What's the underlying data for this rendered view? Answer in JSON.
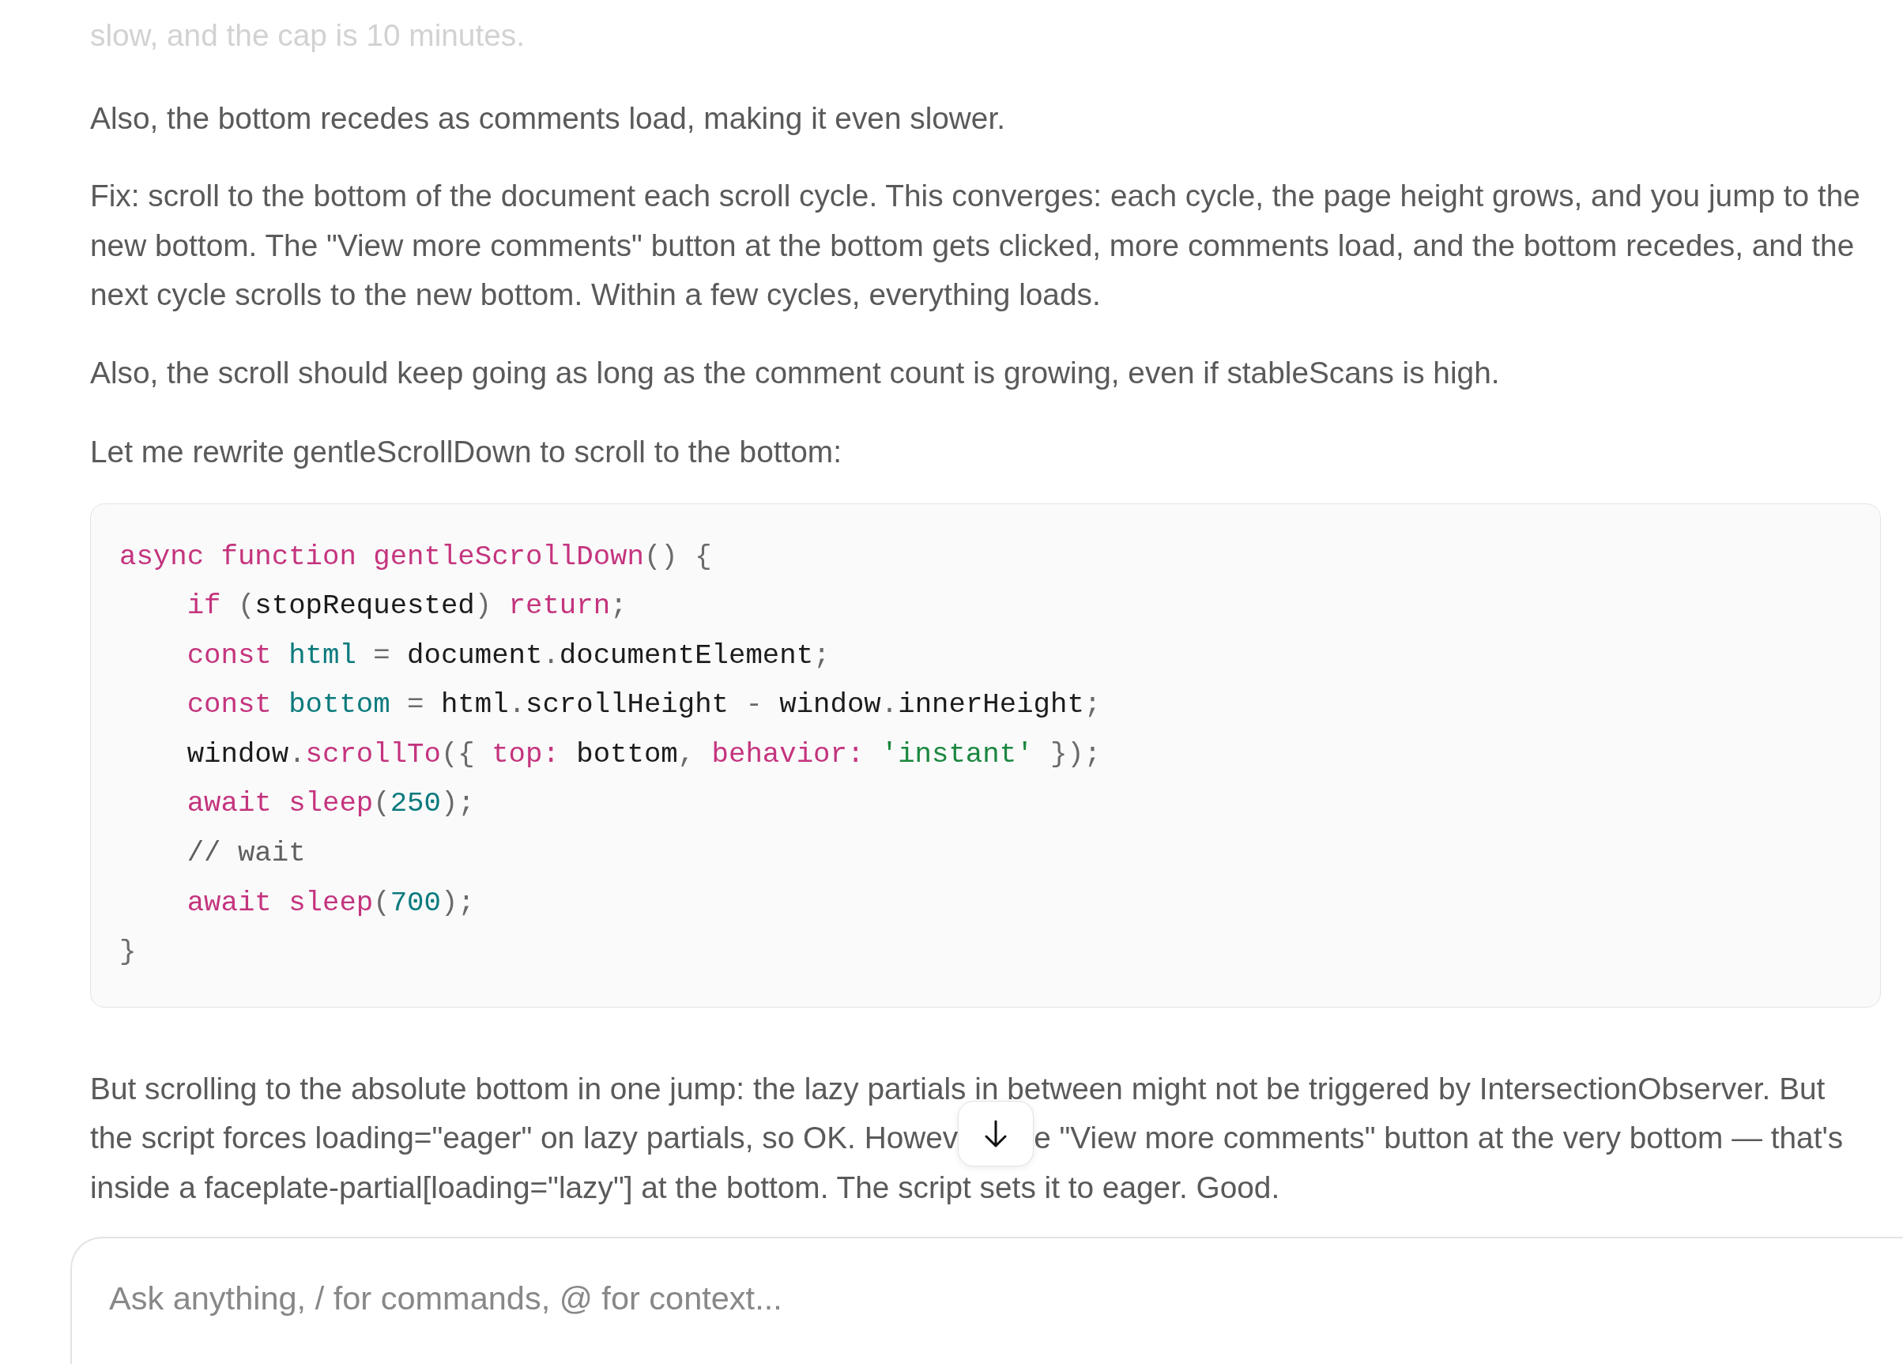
{
  "chat": {
    "faded_text": "slow, and the cap is 10 minutes.",
    "paragraphs": [
      "Also, the bottom recedes as comments load, making it even slower.",
      "Fix: scroll to the bottom of the document each scroll cycle. This converges: each cycle, the page height grows, and you jump to the new bottom. The \"View more comments\" button at the bottom gets clicked, more comments load, and the bottom recedes, and the next cycle scrolls to the new bottom. Within a few cycles, everything loads.",
      "Also, the scroll should keep going as long as the comment count is growing, even if stableScans is high.",
      "Let me rewrite gentleScrollDown to scroll to the bottom:"
    ],
    "code_block": {
      "lines": [
        {
          "tokens": [
            {
              "kind": "keyword",
              "text": "async"
            },
            {
              "kind": "keyword",
              "text": " function"
            },
            {
              "kind": "function",
              "text": " gentleScrollDown"
            },
            {
              "kind": "punct",
              "text": "()"
            },
            {
              "kind": "punct",
              "text": " {"
            }
          ],
          "children": [
            {
              "tokens": [
                {
                  "kind": "keyword",
                  "text": "if"
                },
                {
                  "kind": "punct",
                  "text": " ("
                },
                {
                  "kind": "plain",
                  "text": "stopRequested"
                },
                {
                  "kind": "punct",
                  "text": ")"
                },
                {
                  "kind": "keyword",
                  "text": " return"
                },
                {
                  "kind": "punct",
                  "text": ";"
                }
              ]
            },
            {
              "tokens": [
                {
                  "kind": "keyword",
                  "text": "const"
                },
                {
                  "kind": "variable",
                  "text": " html"
                },
                {
                  "kind": "punct",
                  "text": " ="
                },
                {
                  "kind": "plain",
                  "text": " document"
                },
                {
                  "kind": "punct",
                  "text": "."
                },
                {
                  "kind": "plain",
                  "text": "documentElement"
                },
                {
                  "kind": "punct",
                  "text": ";"
                }
              ]
            },
            {
              "tokens": [
                {
                  "kind": "keyword",
                  "text": "const"
                },
                {
                  "kind": "variable",
                  "text": " bottom"
                },
                {
                  "kind": "punct",
                  "text": " ="
                },
                {
                  "kind": "plain",
                  "text": " html"
                },
                {
                  "kind": "punct",
                  "text": "."
                },
                {
                  "kind": "plain",
                  "text": "scrollHeight"
                },
                {
                  "kind": "punct",
                  "text": " -"
                },
                {
                  "kind": "plain",
                  "text": " window"
                },
                {
                  "kind": "punct",
                  "text": "."
                },
                {
                  "kind": "plain",
                  "text": "innerHeight"
                },
                {
                  "kind": "punct",
                  "text": ";"
                }
              ]
            },
            {
              "tokens": [
                {
                  "kind": "plain",
                  "text": "window"
                },
                {
                  "kind": "punct",
                  "text": "."
                },
                {
                  "kind": "function",
                  "text": "scrollTo"
                },
                {
                  "kind": "punct",
                  "text": "({"
                },
                {
                  "kind": "property",
                  "text": " top:"
                },
                {
                  "kind": "plain",
                  "text": " bottom"
                },
                {
                  "kind": "punct",
                  "text": ","
                },
                {
                  "kind": "property",
                  "text": " behavior:"
                },
                {
                  "kind": "string",
                  "text": " 'instant'"
                },
                {
                  "kind": "punct",
                  "text": " });"
                }
              ]
            },
            {
              "tokens": [
                {
                  "kind": "keyword",
                  "text": "await"
                },
                {
                  "kind": "function",
                  "text": " sleep"
                },
                {
                  "kind": "punct",
                  "text": "("
                },
                {
                  "kind": "number",
                  "text": "250"
                },
                {
                  "kind": "punct",
                  "text": ");"
                }
              ]
            },
            {
              "tokens": [
                {
                  "kind": "comment",
                  "text": "// wait"
                }
              ]
            },
            {
              "tokens": [
                {
                  "kind": "keyword",
                  "text": "await"
                },
                {
                  "kind": "function",
                  "text": " sleep"
                },
                {
                  "kind": "punct",
                  "text": "("
                },
                {
                  "kind": "number",
                  "text": "700"
                },
                {
                  "kind": "punct",
                  "text": ");"
                }
              ]
            }
          ]
        },
        {
          "tokens": [
            {
              "kind": "punct",
              "text": "}"
            }
          ]
        }
      ]
    },
    "closing_paragraph": {
      "lines": [
        {
          "items": [
            {
              "kind": "text",
              "text": "But scrolling to the absolute bottom in one jump: the lazy partials in between might not be triggered by IntersectionObserver. But"
            }
          ]
        },
        {
          "items": [
            {
              "kind": "text",
              "text": "the script forces loading=\"eager\" on lazy partials, so OK. Howev"
            },
            {
              "kind": "scroll_down_button"
            },
            {
              "kind": "text",
              "text": "e \"View more comments\" button at the very bottom — that's"
            }
          ]
        },
        {
          "items": [
            {
              "kind": "text",
              "text": "inside a faceplate-partial[loading=\"lazy\"] at the bottom. The script sets it to eager. Good."
            }
          ]
        }
      ]
    }
  },
  "composer": {
    "placeholder": "Ask anything, / for commands, @ for context..."
  }
}
